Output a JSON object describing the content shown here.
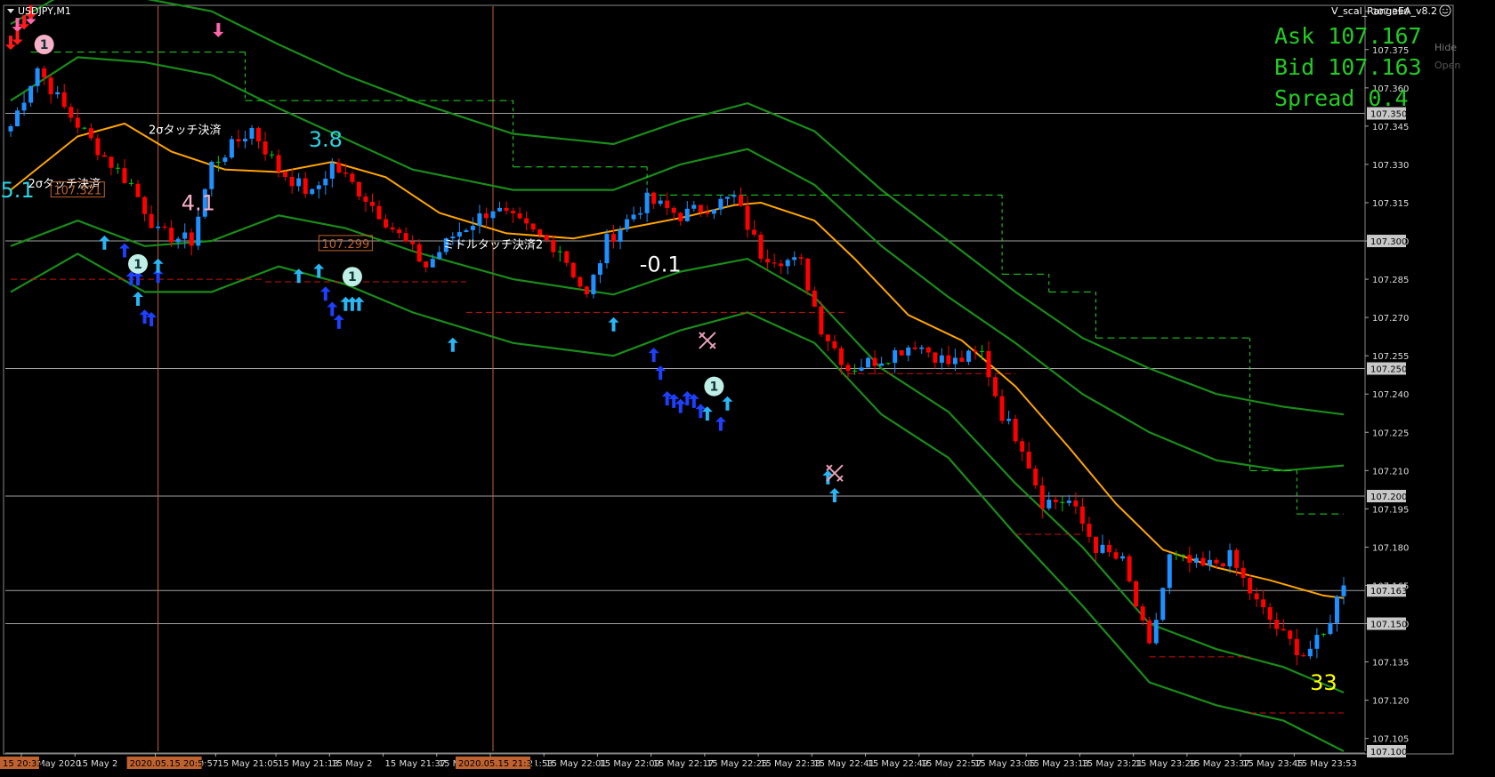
{
  "window": {
    "symbol_label": "USDJPY,M1",
    "ea_label": "V_scal_RangeEA_v8.2",
    "hide_label": "Hide",
    "open_label": "Open"
  },
  "quote_panel": {
    "ask_label": "Ask 107.167",
    "bid_label": "Bid 107.163",
    "spread_label": "Spread 0.4"
  },
  "colors": {
    "background": "#000000",
    "bull_candle": "#1e90ff",
    "bear_candle": "#ff0000",
    "doji_candle": "#00cc00",
    "ma_line": "#ffa500",
    "band_line": "#1a8c1a",
    "quote_text": "#22cc22",
    "entry_arrow_light": "#29b6f6",
    "entry_arrow_dark": "#1e40ff",
    "exit_arrow": "#ff66aa",
    "vline": "#c0622f",
    "hline": "#c8c8c8",
    "dashed_support": "#cc1111",
    "dashed_trail": "#22dd22"
  },
  "price_axis": {
    "ticks": [
      "107.390",
      "107.375",
      "107.360",
      "107.345",
      "107.330",
      "107.315",
      "107.300",
      "107.285",
      "107.270",
      "107.255",
      "107.240",
      "107.225",
      "107.210",
      "107.195",
      "107.180",
      "107.165",
      "107.150",
      "107.135",
      "107.120",
      "107.105"
    ],
    "highlighted": [
      {
        "label": "107.350",
        "value": 107.35
      },
      {
        "label": "107.300",
        "value": 107.3
      },
      {
        "label": "107.250",
        "value": 107.25
      },
      {
        "label": "107.200",
        "value": 107.2
      },
      {
        "label": "107.163",
        "value": 107.163
      },
      {
        "label": "107.150",
        "value": 107.15
      },
      {
        "label": "107.100",
        "value": 107.1
      }
    ]
  },
  "time_axis": {
    "ticks": [
      "15 May 2020",
      "15 May 2",
      "15 May 20:57",
      "15 May 21:05",
      "15 May 21:13",
      "15 May 2",
      "15 May 21:37",
      "15 May 21:45",
      "15 May 21:53",
      "15 May 22:01",
      "15 May 22:09",
      "15 May 22:17",
      "15 May 22:25",
      "15 May 22:33",
      "15 May 22:41",
      "15 May 22:49",
      "15 May 22:57",
      "15 May 23:05",
      "15 May 23:13",
      "15 May 23:21",
      "15 May 23:29",
      "15 May 23:37",
      "15 May 23:45",
      "15 May 23:53"
    ],
    "highlight_first": "15 20:33",
    "highlight_v1": "2020.05.15 20:51",
    "highlight_v2": "2020.05.15 21:31"
  },
  "annotations": {
    "pnl": [
      {
        "text": "5.1",
        "color": "#29d4e6",
        "bar": 1,
        "price": 107.317
      },
      {
        "text": "4.1",
        "color": "#f6b0c8",
        "bar": 28,
        "price": 107.312
      },
      {
        "text": "3.8",
        "color": "#29d4e6",
        "bar": 47,
        "price": 107.337
      },
      {
        "text": "-0.1",
        "color": "#ffffff",
        "bar": 97,
        "price": 107.288
      },
      {
        "text": "33",
        "color": "#ffff00",
        "bar": 196,
        "price": 107.124
      }
    ],
    "close_labels": [
      {
        "text": "2σタッチ決済",
        "bar": 8,
        "price": 107.321
      },
      {
        "text": "2σタッチ決済",
        "bar": 26,
        "price": 107.342
      },
      {
        "text": "ミドルタッチ決済2",
        "bar": 72,
        "price": 107.297
      }
    ],
    "price_tags": [
      {
        "text": "107.321",
        "bar": 10,
        "price": 107.32
      },
      {
        "text": "107.299",
        "bar": 50,
        "price": 107.299
      }
    ]
  },
  "chart_data": {
    "type": "candlestick",
    "symbol": "USDJPY",
    "timeframe": "M1",
    "ylim": [
      107.1,
      107.392
    ],
    "x_start": "2020.05.15 20:33",
    "x_end": "2020.05.15 23:56",
    "horizontal_levels": [
      107.35,
      107.3,
      107.25,
      107.2,
      107.163,
      107.15
    ],
    "vertical_lines": [
      "2020.05.15 20:51",
      "2020.05.15 21:31"
    ],
    "close_anchor_points": [
      {
        "bar": 0,
        "close": 107.345
      },
      {
        "bar": 4,
        "close": 107.368
      },
      {
        "bar": 8,
        "close": 107.352
      },
      {
        "bar": 14,
        "close": 107.333
      },
      {
        "bar": 18,
        "close": 107.322
      },
      {
        "bar": 22,
        "close": 107.303
      },
      {
        "bar": 27,
        "close": 107.3
      },
      {
        "bar": 30,
        "close": 107.33
      },
      {
        "bar": 36,
        "close": 107.344
      },
      {
        "bar": 40,
        "close": 107.328
      },
      {
        "bar": 45,
        "close": 107.318
      },
      {
        "bar": 48,
        "close": 107.33
      },
      {
        "bar": 53,
        "close": 107.317
      },
      {
        "bar": 58,
        "close": 107.302
      },
      {
        "bar": 62,
        "close": 107.29
      },
      {
        "bar": 66,
        "close": 107.302
      },
      {
        "bar": 72,
        "close": 107.313
      },
      {
        "bar": 78,
        "close": 107.303
      },
      {
        "bar": 82,
        "close": 107.297
      },
      {
        "bar": 86,
        "close": 107.278
      },
      {
        "bar": 89,
        "close": 107.3
      },
      {
        "bar": 95,
        "close": 107.316
      },
      {
        "bar": 100,
        "close": 107.31
      },
      {
        "bar": 108,
        "close": 107.317
      },
      {
        "bar": 112,
        "close": 107.295
      },
      {
        "bar": 118,
        "close": 107.291
      },
      {
        "bar": 121,
        "close": 107.266
      },
      {
        "bar": 125,
        "close": 107.25
      },
      {
        "bar": 130,
        "close": 107.254
      },
      {
        "bar": 135,
        "close": 107.26
      },
      {
        "bar": 140,
        "close": 107.252
      },
      {
        "bar": 145,
        "close": 107.256
      },
      {
        "bar": 148,
        "close": 107.232
      },
      {
        "bar": 151,
        "close": 107.22
      },
      {
        "bar": 154,
        "close": 107.198
      },
      {
        "bar": 158,
        "close": 107.198
      },
      {
        "bar": 162,
        "close": 107.18
      },
      {
        "bar": 166,
        "close": 107.174
      },
      {
        "bar": 170,
        "close": 107.14
      },
      {
        "bar": 173,
        "close": 107.176
      },
      {
        "bar": 178,
        "close": 107.172
      },
      {
        "bar": 182,
        "close": 107.176
      },
      {
        "bar": 186,
        "close": 107.158
      },
      {
        "bar": 190,
        "close": 107.145
      },
      {
        "bar": 193,
        "close": 107.138
      },
      {
        "bar": 196,
        "close": 107.145
      },
      {
        "bar": 199,
        "close": 107.167
      }
    ],
    "moving_average": [
      {
        "bar": 0,
        "value": 107.32
      },
      {
        "bar": 10,
        "value": 107.341
      },
      {
        "bar": 17,
        "value": 107.346
      },
      {
        "bar": 24,
        "value": 107.335
      },
      {
        "bar": 32,
        "value": 107.328
      },
      {
        "bar": 40,
        "value": 107.327
      },
      {
        "bar": 48,
        "value": 107.331
      },
      {
        "bar": 56,
        "value": 107.325
      },
      {
        "bar": 64,
        "value": 107.311
      },
      {
        "bar": 74,
        "value": 107.303
      },
      {
        "bar": 84,
        "value": 107.301
      },
      {
        "bar": 92,
        "value": 107.305
      },
      {
        "bar": 100,
        "value": 107.309
      },
      {
        "bar": 108,
        "value": 107.314
      },
      {
        "bar": 112,
        "value": 107.315
      },
      {
        "bar": 120,
        "value": 107.308
      },
      {
        "bar": 126,
        "value": 107.293
      },
      {
        "bar": 134,
        "value": 107.271
      },
      {
        "bar": 142,
        "value": 107.261
      },
      {
        "bar": 150,
        "value": 107.243
      },
      {
        "bar": 158,
        "value": 107.219
      },
      {
        "bar": 165,
        "value": 107.197
      },
      {
        "bar": 172,
        "value": 107.179
      },
      {
        "bar": 180,
        "value": 107.172
      },
      {
        "bar": 188,
        "value": 107.167
      },
      {
        "bar": 196,
        "value": 107.161
      },
      {
        "bar": 199,
        "value": 107.16
      }
    ],
    "bands": [
      {
        "name": "upper_outer",
        "points": [
          [
            0,
            107.385
          ],
          [
            10,
            107.4
          ],
          [
            20,
            107.395
          ],
          [
            30,
            107.39
          ],
          [
            40,
            107.377
          ],
          [
            50,
            107.365
          ],
          [
            60,
            107.355
          ],
          [
            75,
            107.342
          ],
          [
            90,
            107.338
          ],
          [
            100,
            107.347
          ],
          [
            110,
            107.354
          ],
          [
            120,
            107.343
          ],
          [
            130,
            107.32
          ],
          [
            140,
            107.3
          ],
          [
            150,
            107.28
          ],
          [
            160,
            107.262
          ],
          [
            170,
            107.25
          ],
          [
            180,
            107.24
          ],
          [
            190,
            107.235
          ],
          [
            199,
            107.232
          ]
        ]
      },
      {
        "name": "upper_inner",
        "points": [
          [
            0,
            107.355
          ],
          [
            10,
            107.372
          ],
          [
            20,
            107.37
          ],
          [
            30,
            107.365
          ],
          [
            40,
            107.352
          ],
          [
            50,
            107.34
          ],
          [
            60,
            107.328
          ],
          [
            75,
            107.32
          ],
          [
            90,
            107.32
          ],
          [
            100,
            107.33
          ],
          [
            110,
            107.336
          ],
          [
            120,
            107.322
          ],
          [
            130,
            107.298
          ],
          [
            140,
            107.278
          ],
          [
            150,
            107.26
          ],
          [
            160,
            107.24
          ],
          [
            170,
            107.225
          ],
          [
            180,
            107.214
          ],
          [
            190,
            107.21
          ],
          [
            199,
            107.212
          ]
        ]
      },
      {
        "name": "lower_inner",
        "points": [
          [
            0,
            107.298
          ],
          [
            10,
            107.308
          ],
          [
            20,
            107.298
          ],
          [
            30,
            107.3
          ],
          [
            40,
            107.31
          ],
          [
            50,
            107.305
          ],
          [
            60,
            107.296
          ],
          [
            75,
            107.285
          ],
          [
            90,
            107.279
          ],
          [
            100,
            107.288
          ],
          [
            110,
            107.293
          ],
          [
            120,
            107.278
          ],
          [
            130,
            107.25
          ],
          [
            140,
            107.233
          ],
          [
            150,
            107.205
          ],
          [
            160,
            107.18
          ],
          [
            170,
            107.15
          ],
          [
            180,
            107.14
          ],
          [
            190,
            107.133
          ],
          [
            199,
            107.123
          ]
        ]
      },
      {
        "name": "lower_outer",
        "points": [
          [
            0,
            107.28
          ],
          [
            10,
            107.295
          ],
          [
            20,
            107.28
          ],
          [
            30,
            107.28
          ],
          [
            40,
            107.29
          ],
          [
            50,
            107.283
          ],
          [
            60,
            107.272
          ],
          [
            75,
            107.26
          ],
          [
            90,
            107.255
          ],
          [
            100,
            107.265
          ],
          [
            110,
            107.272
          ],
          [
            120,
            107.26
          ],
          [
            130,
            107.232
          ],
          [
            140,
            107.215
          ],
          [
            150,
            107.185
          ],
          [
            160,
            107.157
          ],
          [
            170,
            107.127
          ],
          [
            180,
            107.118
          ],
          [
            190,
            107.112
          ],
          [
            199,
            107.1
          ]
        ]
      }
    ],
    "support_dashed": [
      {
        "from": 0,
        "to": 38,
        "price": 107.285
      },
      {
        "from": 38,
        "to": 68,
        "price": 107.284
      },
      {
        "from": 68,
        "to": 125,
        "price": 107.272
      },
      {
        "from": 125,
        "to": 150,
        "price": 107.248
      },
      {
        "from": 150,
        "to": 160,
        "price": 107.185
      },
      {
        "from": 170,
        "to": 185,
        "price": 107.137
      },
      {
        "from": 185,
        "to": 199,
        "price": 107.115
      }
    ],
    "trail_dashed": [
      {
        "from": 3,
        "to": 35,
        "price": 107.374
      },
      {
        "from": 35,
        "to": 75,
        "price": 107.355
      },
      {
        "from": 75,
        "to": 95,
        "price": 107.329
      },
      {
        "from": 95,
        "to": 130,
        "price": 107.318
      },
      {
        "from": 130,
        "to": 148,
        "price": 107.318
      },
      {
        "from": 148,
        "to": 155,
        "price": 107.287
      },
      {
        "from": 155,
        "to": 162,
        "price": 107.28
      },
      {
        "from": 162,
        "to": 170,
        "price": 107.262
      },
      {
        "from": 170,
        "to": 185,
        "price": 107.262
      },
      {
        "from": 185,
        "to": 192,
        "price": 107.21
      },
      {
        "from": 192,
        "to": 199,
        "price": 107.193
      }
    ],
    "entry_arrows": [
      {
        "bar": 14,
        "price": 107.299,
        "shade": "light"
      },
      {
        "bar": 17,
        "price": 107.296,
        "shade": "dark"
      },
      {
        "bar": 18,
        "price": 107.285,
        "shade": "dark"
      },
      {
        "bar": 19,
        "price": 107.285,
        "shade": "dark"
      },
      {
        "bar": 19,
        "price": 107.277,
        "shade": "light"
      },
      {
        "bar": 20,
        "price": 107.27,
        "shade": "dark"
      },
      {
        "bar": 21,
        "price": 107.269,
        "shade": "dark"
      },
      {
        "bar": 22,
        "price": 107.286,
        "shade": "dark"
      },
      {
        "bar": 22,
        "price": 107.29,
        "shade": "light"
      },
      {
        "bar": 43,
        "price": 107.286,
        "shade": "light"
      },
      {
        "bar": 46,
        "price": 107.288,
        "shade": "light"
      },
      {
        "bar": 47,
        "price": 107.279,
        "shade": "dark"
      },
      {
        "bar": 48,
        "price": 107.273,
        "shade": "dark"
      },
      {
        "bar": 49,
        "price": 107.268,
        "shade": "dark"
      },
      {
        "bar": 50,
        "price": 107.275,
        "shade": "light"
      },
      {
        "bar": 51,
        "price": 107.275,
        "shade": "light"
      },
      {
        "bar": 52,
        "price": 107.275,
        "shade": "light"
      },
      {
        "bar": 66,
        "price": 107.259,
        "shade": "light"
      },
      {
        "bar": 90,
        "price": 107.267,
        "shade": "light"
      },
      {
        "bar": 96,
        "price": 107.255,
        "shade": "dark"
      },
      {
        "bar": 97,
        "price": 107.248,
        "shade": "dark"
      },
      {
        "bar": 98,
        "price": 107.238,
        "shade": "dark"
      },
      {
        "bar": 99,
        "price": 107.237,
        "shade": "dark"
      },
      {
        "bar": 100,
        "price": 107.235,
        "shade": "dark"
      },
      {
        "bar": 101,
        "price": 107.238,
        "shade": "dark"
      },
      {
        "bar": 102,
        "price": 107.237,
        "shade": "dark"
      },
      {
        "bar": 103,
        "price": 107.233,
        "shade": "dark"
      },
      {
        "bar": 104,
        "price": 107.232,
        "shade": "light"
      },
      {
        "bar": 106,
        "price": 107.228,
        "shade": "dark"
      },
      {
        "bar": 107,
        "price": 107.236,
        "shade": "light"
      },
      {
        "bar": 122,
        "price": 107.207,
        "shade": "light"
      },
      {
        "bar": 123,
        "price": 107.2,
        "shade": "light"
      }
    ],
    "exit_arrows": [
      {
        "bar": 31,
        "price": 107.383
      },
      {
        "bar": 3,
        "price": 107.388
      },
      {
        "bar": 1,
        "price": 107.385
      }
    ],
    "trade_markers": [
      {
        "bar": 5,
        "price": 107.377,
        "label": "1",
        "color": "#f6b0c8"
      },
      {
        "bar": 19,
        "price": 107.291,
        "label": "1",
        "color": "#bfeee6"
      },
      {
        "bar": 51,
        "price": 107.286,
        "label": "1",
        "color": "#bfeee6"
      },
      {
        "bar": 105,
        "price": 107.243,
        "label": "1",
        "color": "#bfeee6"
      }
    ],
    "x_markers": [
      {
        "bar": 104,
        "price": 107.261
      },
      {
        "bar": 123,
        "price": 107.209
      }
    ]
  }
}
